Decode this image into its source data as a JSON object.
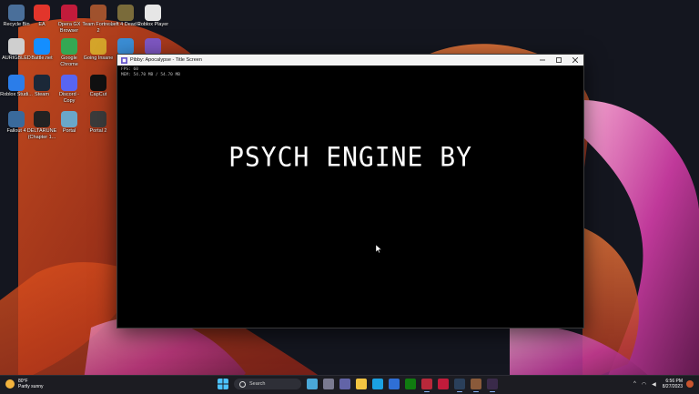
{
  "desktop": {
    "icons": [
      {
        "label": "Recycle Bin",
        "icon": "recycle-bin-icon",
        "color": "#4a6f9a"
      },
      {
        "label": "EA",
        "icon": "ea-icon",
        "color": "#e2352b"
      },
      {
        "label": "Opera GX Browser",
        "icon": "opera-gx-icon",
        "color": "#c21b3b"
      },
      {
        "label": "Team Fortress 2",
        "icon": "team-fortress-2-icon",
        "color": "#a0522d"
      },
      {
        "label": "Left 4 Dead 2",
        "icon": "left-4-dead-2-icon",
        "color": "#7a6b3a"
      },
      {
        "label": "Roblox Player",
        "icon": "roblox-player-icon",
        "color": "#e6e6e6"
      },
      {
        "label": "AURIGBLED",
        "icon": "aurigbled-icon",
        "color": "#cfcfcf"
      },
      {
        "label": "Battle.net",
        "icon": "battlenet-icon",
        "color": "#148eff"
      },
      {
        "label": "Google Chrome",
        "icon": "chrome-icon",
        "color": "#34a853"
      },
      {
        "label": "Going Insane",
        "icon": "going-insane-icon",
        "color": "#d4a42a"
      },
      {
        "label": "Fnf",
        "icon": "fnf-icon",
        "color": "#3b8ed6"
      },
      {
        "label": "Ap",
        "icon": "app-icon",
        "color": "#7e57c2"
      },
      {
        "label": "Roblox Studi...",
        "icon": "roblox-studio-icon",
        "color": "#2b7de9"
      },
      {
        "label": "Steam",
        "icon": "steam-icon",
        "color": "#1b2838"
      },
      {
        "label": "Discord - Copy",
        "icon": "discord-icon",
        "color": "#5865f2"
      },
      {
        "label": "CapCut",
        "icon": "capcut-icon",
        "color": "#111111"
      },
      {
        "label": "Fallout 4",
        "icon": "fallout-4-icon",
        "color": "#3a6a9c"
      },
      {
        "label": "DELTARUNE (Chapter 1...",
        "icon": "deltarune-icon",
        "color": "#222222"
      },
      {
        "label": "Portal",
        "icon": "portal-icon",
        "color": "#6aa7c9"
      },
      {
        "label": "Portal 2",
        "icon": "portal-2-icon",
        "color": "#3b3b3b"
      }
    ]
  },
  "window": {
    "title": "Pibby: Apocalypse - Title Screen",
    "fps_line": "FPS: 60",
    "mem_line": "MEM: 54.70 MB / 54.70 MB",
    "intro_text": "PSYCH ENGINE BY"
  },
  "taskbar": {
    "weather_temp": "80°F",
    "weather_desc": "Partly sunny",
    "search_placeholder": "Search",
    "time": "6:56 PM",
    "date": "8/27/2023",
    "pinned": [
      {
        "icon": "widgets-icon",
        "color": "#4aa8d8",
        "running": false
      },
      {
        "icon": "task-view-icon",
        "color": "#7a7a90",
        "running": false
      },
      {
        "icon": "teams-chat-icon",
        "color": "#6264a7",
        "running": false
      },
      {
        "icon": "file-explorer-icon",
        "color": "#f4c542",
        "running": false
      },
      {
        "icon": "edge-icon",
        "color": "#1ba1e2",
        "running": false
      },
      {
        "icon": "microsoft-store-icon",
        "color": "#2f6fd6",
        "running": false
      },
      {
        "icon": "xbox-icon",
        "color": "#107c10",
        "running": false
      },
      {
        "icon": "game-launcher-icon",
        "color": "#b8283a",
        "running": true
      },
      {
        "icon": "opera-gx-taskbar-icon",
        "color": "#c21b3b",
        "running": false
      },
      {
        "icon": "steam-taskbar-icon",
        "color": "#2a3f5a",
        "running": true
      },
      {
        "icon": "game-taskbar-icon",
        "color": "#8a5a3a",
        "running": true
      },
      {
        "icon": "pibby-game-icon",
        "color": "#3a2a4a",
        "running": true
      }
    ]
  }
}
